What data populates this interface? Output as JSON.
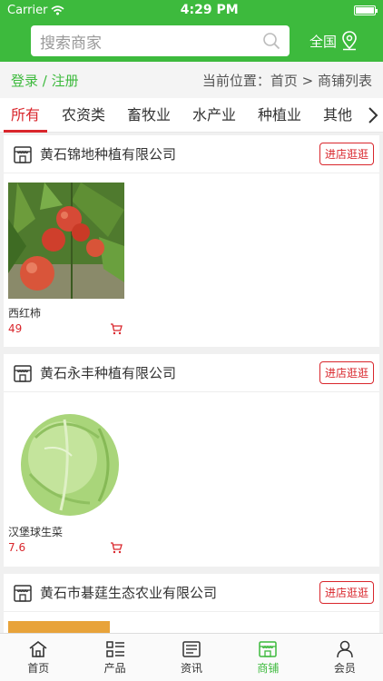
{
  "status_bar": {
    "carrier": "Carrier",
    "time": "4:29 PM"
  },
  "search": {
    "placeholder": "搜索商家"
  },
  "region": {
    "label": "全国"
  },
  "breadcrumb": {
    "login": "登录 / 注册",
    "location": "当前位置：首页 > 商铺列表"
  },
  "tabs": [
    {
      "label": "所有"
    },
    {
      "label": "农资类"
    },
    {
      "label": "畜牧业"
    },
    {
      "label": "水产业"
    },
    {
      "label": "种植业"
    },
    {
      "label": "其他"
    }
  ],
  "visit_label": "进店逛逛",
  "stores": [
    {
      "name": "黄石锦地种植有限公司",
      "product": {
        "name": "西红柿",
        "price": "49"
      }
    },
    {
      "name": "黄石永丰种植有限公司",
      "product": {
        "name": "汉堡球生菜",
        "price": "7.6"
      }
    },
    {
      "name": "黄石市碁莛生态农业有限公司"
    }
  ],
  "tabbar": [
    {
      "label": "首页",
      "icon": "home-icon"
    },
    {
      "label": "产品",
      "icon": "grid-list-icon"
    },
    {
      "label": "资讯",
      "icon": "news-icon"
    },
    {
      "label": "商铺",
      "icon": "store-icon"
    },
    {
      "label": "会员",
      "icon": "user-icon"
    }
  ],
  "colors": {
    "brand_green": "#3dba3d",
    "accent_red": "#d9262c"
  }
}
